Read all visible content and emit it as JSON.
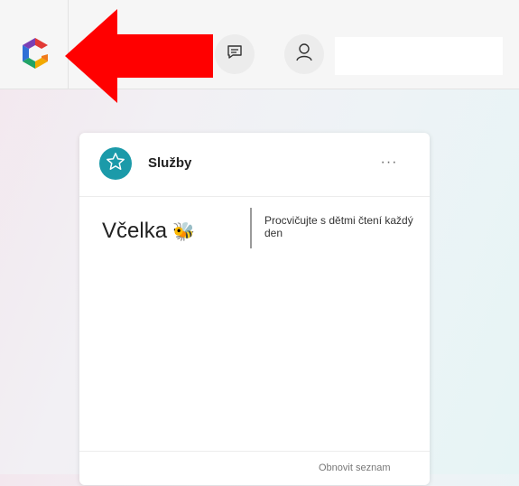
{
  "card": {
    "title": "Služby",
    "more_label": "···",
    "app_name": "Včelka",
    "app_emoji": "🐝",
    "app_description": "Procvičujte s dětmi čtení každý den",
    "refresh_label": "Obnovit seznam"
  },
  "icons": {
    "logo": "app-logo-icon",
    "chat": "chat-icon",
    "user": "user-icon",
    "star": "star-icon",
    "arrow": "red-arrow-annotation"
  },
  "colors": {
    "arrow": "#ff0000",
    "service_icon_bg": "#1b9aa9"
  }
}
